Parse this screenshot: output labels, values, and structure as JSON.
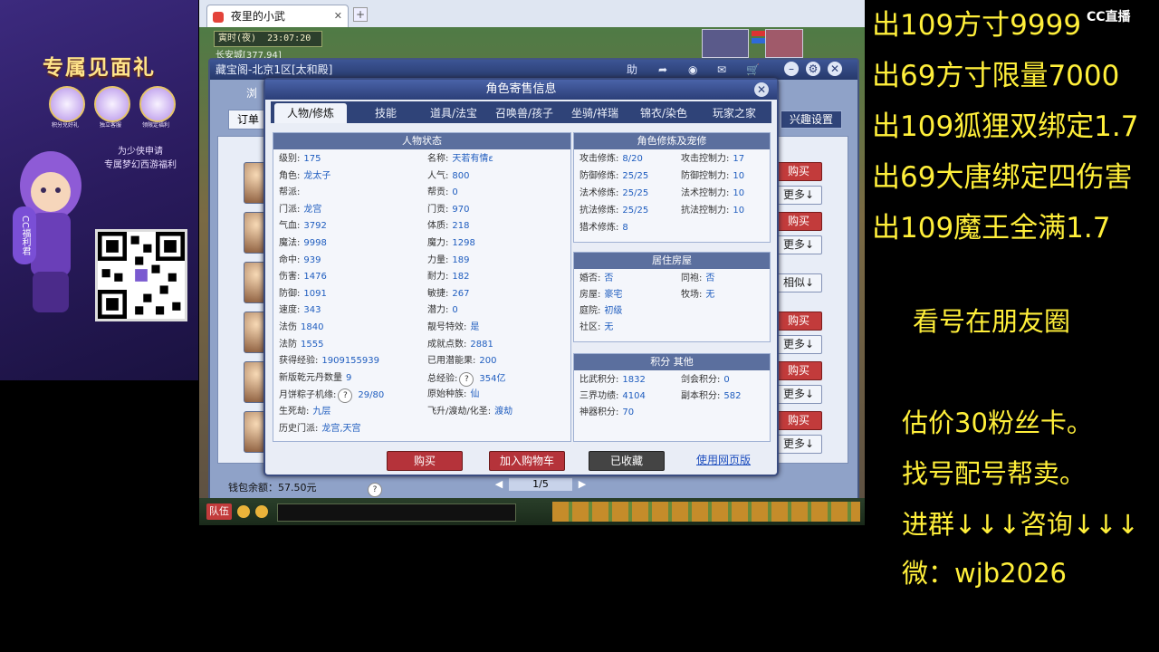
{
  "promo": {
    "title": "专属见面礼",
    "icon_labels": [
      "积分兑好礼",
      "独立客服",
      "领限定福利"
    ],
    "subtitle_line1": "为少侠申请",
    "subtitle_line2": "专属梦幻西游福利",
    "badge": "CC福利君"
  },
  "game": {
    "tab_title": "夜里的小武",
    "clock": "寅时(夜)",
    "time": "23:07:20",
    "location": "长安城[377,94]",
    "shop_header": "藏宝阁-北京1区[太和殿]",
    "order_label": "订单",
    "browse_label": "浏",
    "interest_settings": "兴趣设置",
    "wallet_label": "钱包余额：57.50元",
    "page": "1/5",
    "team_label": "队伍",
    "row_buttons": [
      {
        "top": "购买",
        "bottom": "更多↓"
      },
      {
        "top": "购买",
        "bottom": "更多↓"
      },
      {
        "top": "相似↓",
        "bottom": ""
      },
      {
        "top": "购买",
        "bottom": "更多↓"
      },
      {
        "top": "购买",
        "bottom": "更多↓"
      },
      {
        "top": "购买",
        "bottom": "更多↓"
      }
    ]
  },
  "dialog": {
    "title": "角色寄售信息",
    "tabs": [
      "人物/修炼",
      "技能",
      "道具/法宝",
      "召唤兽/孩子",
      "坐骑/祥瑞",
      "锦衣/染色",
      "玩家之家"
    ],
    "status_header": "人物状态",
    "left_col": [
      {
        "k": "级别:",
        "v": "175"
      },
      {
        "k": "角色:",
        "v": "龙太子"
      },
      {
        "k": "帮派:",
        "v": ""
      },
      {
        "k": "门派:",
        "v": "龙宫"
      },
      {
        "k": "气血:",
        "v": "3792"
      },
      {
        "k": "魔法:",
        "v": "9998"
      },
      {
        "k": "命中:",
        "v": "939"
      },
      {
        "k": "伤害:",
        "v": "1476"
      },
      {
        "k": "防御:",
        "v": "1091"
      },
      {
        "k": "速度:",
        "v": "343"
      },
      {
        "k": "法伤",
        "v": "1840"
      },
      {
        "k": "法防",
        "v": "1555"
      },
      {
        "k": "获得经验:",
        "v": "1909155939"
      },
      {
        "k": "新版乾元丹数量",
        "v": "9"
      },
      {
        "k": "月饼粽子机缘:",
        "v": "29/80"
      },
      {
        "k": "生死劫:",
        "v": "九层"
      },
      {
        "k": "历史门派:",
        "v": "龙宫,天宫"
      }
    ],
    "mid_col": [
      {
        "k": "名称:",
        "v": "天若有情ε"
      },
      {
        "k": "人气:",
        "v": "800"
      },
      {
        "k": "帮贡:",
        "v": "0"
      },
      {
        "k": "门贡:",
        "v": "970"
      },
      {
        "k": "体质:",
        "v": "218"
      },
      {
        "k": "魔力:",
        "v": "1298"
      },
      {
        "k": "力量:",
        "v": "189"
      },
      {
        "k": "耐力:",
        "v": "182"
      },
      {
        "k": "敏捷:",
        "v": "267"
      },
      {
        "k": "潜力:",
        "v": "0"
      },
      {
        "k": "靓号特效:",
        "v": "是"
      },
      {
        "k": "成就点数:",
        "v": "2881"
      },
      {
        "k": "已用潜能果:",
        "v": "200"
      },
      {
        "k": "总经验:",
        "v": "354亿"
      },
      {
        "k": "原始种族:",
        "v": "仙"
      },
      {
        "k": "飞升/渡劫/化圣:",
        "v": "渡劫"
      }
    ],
    "cult_header": "角色修炼及宠修",
    "cult": [
      {
        "k": "攻击修炼:",
        "v": "8/20",
        "k2": "攻击控制力:",
        "v2": "17"
      },
      {
        "k": "防御修炼:",
        "v": "25/25",
        "k2": "防御控制力:",
        "v2": "10"
      },
      {
        "k": "法术修炼:",
        "v": "25/25",
        "k2": "法术控制力:",
        "v2": "10"
      },
      {
        "k": "抗法修炼:",
        "v": "25/25",
        "k2": "抗法控制力:",
        "v2": "10"
      },
      {
        "k": "猎术修炼:",
        "v": "8",
        "k2": "",
        "v2": ""
      }
    ],
    "house_header": "居住房屋",
    "house": [
      {
        "k": "婚否:",
        "v": "否",
        "k2": "同袍:",
        "v2": "否"
      },
      {
        "k": "房屋:",
        "v": "豪宅",
        "k2": "牧场:",
        "v2": "无"
      },
      {
        "k": "庭院:",
        "v": "初级",
        "k2": "",
        "v2": ""
      },
      {
        "k": "社区:",
        "v": "无",
        "k2": "",
        "v2": ""
      }
    ],
    "score_header": "积分 其他",
    "score": [
      {
        "k": "比武积分:",
        "v": "1832",
        "k2": "剑会积分:",
        "v2": "0"
      },
      {
        "k": "三界功绩:",
        "v": "4104",
        "k2": "副本积分:",
        "v2": "582"
      },
      {
        "k": "神器积分:",
        "v": "70",
        "k2": "",
        "v2": ""
      }
    ],
    "buttons": {
      "buy": "购买",
      "add_cart": "加入购物车",
      "favorited": "已收藏",
      "web": "使用网页版"
    }
  },
  "overlay": {
    "sales": [
      "出109方寸9999",
      "出69方寸限量7000",
      "出109狐狸双绑定1.7",
      "出69大唐绑定四伤害",
      "出109魔王全满1.7"
    ],
    "friend": "看号在朋友圈",
    "notes": [
      "估价30粉丝卡。",
      "找号配号帮卖。",
      "进群↓↓↓咨询↓↓↓",
      "微：wjb2026"
    ],
    "watermark": "CC直播"
  },
  "colors": {
    "overlay_text": "#ffef3a",
    "buy_button": "#c23b3b",
    "dialog_header": "#2c3f78"
  }
}
